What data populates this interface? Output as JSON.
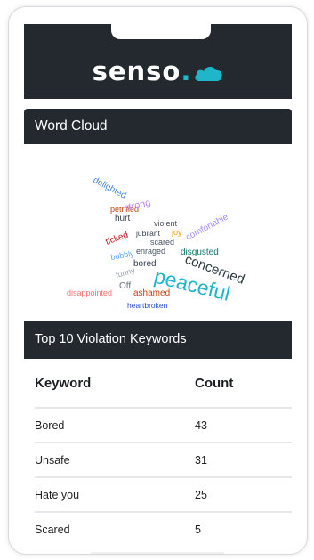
{
  "app": {
    "logo_text": "senso",
    "logo_dot": ".",
    "accent_color": "#1fb6c9",
    "header_color": "#24292f"
  },
  "word_cloud": {
    "title": "Word Cloud",
    "words": [
      {
        "text": "peaceful",
        "color": "#1fb6c9"
      },
      {
        "text": "concerned",
        "color": "#2b3a3f"
      },
      {
        "text": "delighted",
        "color": "#4b8ad6"
      },
      {
        "text": "petrified",
        "color": "#c2410c"
      },
      {
        "text": "hurt",
        "color": "#374151"
      },
      {
        "text": "violent",
        "color": "#4b5563"
      },
      {
        "text": "comfortable",
        "color": "#a78bfa"
      },
      {
        "text": "jubilant",
        "color": "#374151"
      },
      {
        "text": "scared",
        "color": "#475569"
      },
      {
        "text": "disgusted",
        "color": "#0f766e"
      },
      {
        "text": "enraged",
        "color": "#475569"
      },
      {
        "text": "strong",
        "color": "#c084fc"
      },
      {
        "text": "bored",
        "color": "#334155"
      },
      {
        "text": "ticked",
        "color": "#b91c1c"
      },
      {
        "text": "bubbly",
        "color": "#60a5fa"
      },
      {
        "text": "funny",
        "color": "#9ca3af"
      },
      {
        "text": "Off",
        "color": "#6b7280"
      },
      {
        "text": "ashamed",
        "color": "#c2410c"
      },
      {
        "text": "heartbroken",
        "color": "#1d4ed8"
      },
      {
        "text": "disappointed",
        "color": "#f87171"
      },
      {
        "text": "joy",
        "color": "#f59e0b"
      }
    ]
  },
  "violations": {
    "title": "Top 10 Violation Keywords",
    "columns": [
      "Keyword",
      "Count"
    ],
    "rows": [
      {
        "keyword": "Bored",
        "count": "43"
      },
      {
        "keyword": "Unsafe",
        "count": "31"
      },
      {
        "keyword": "Hate you",
        "count": "25"
      },
      {
        "keyword": "Scared",
        "count": "5"
      }
    ]
  }
}
